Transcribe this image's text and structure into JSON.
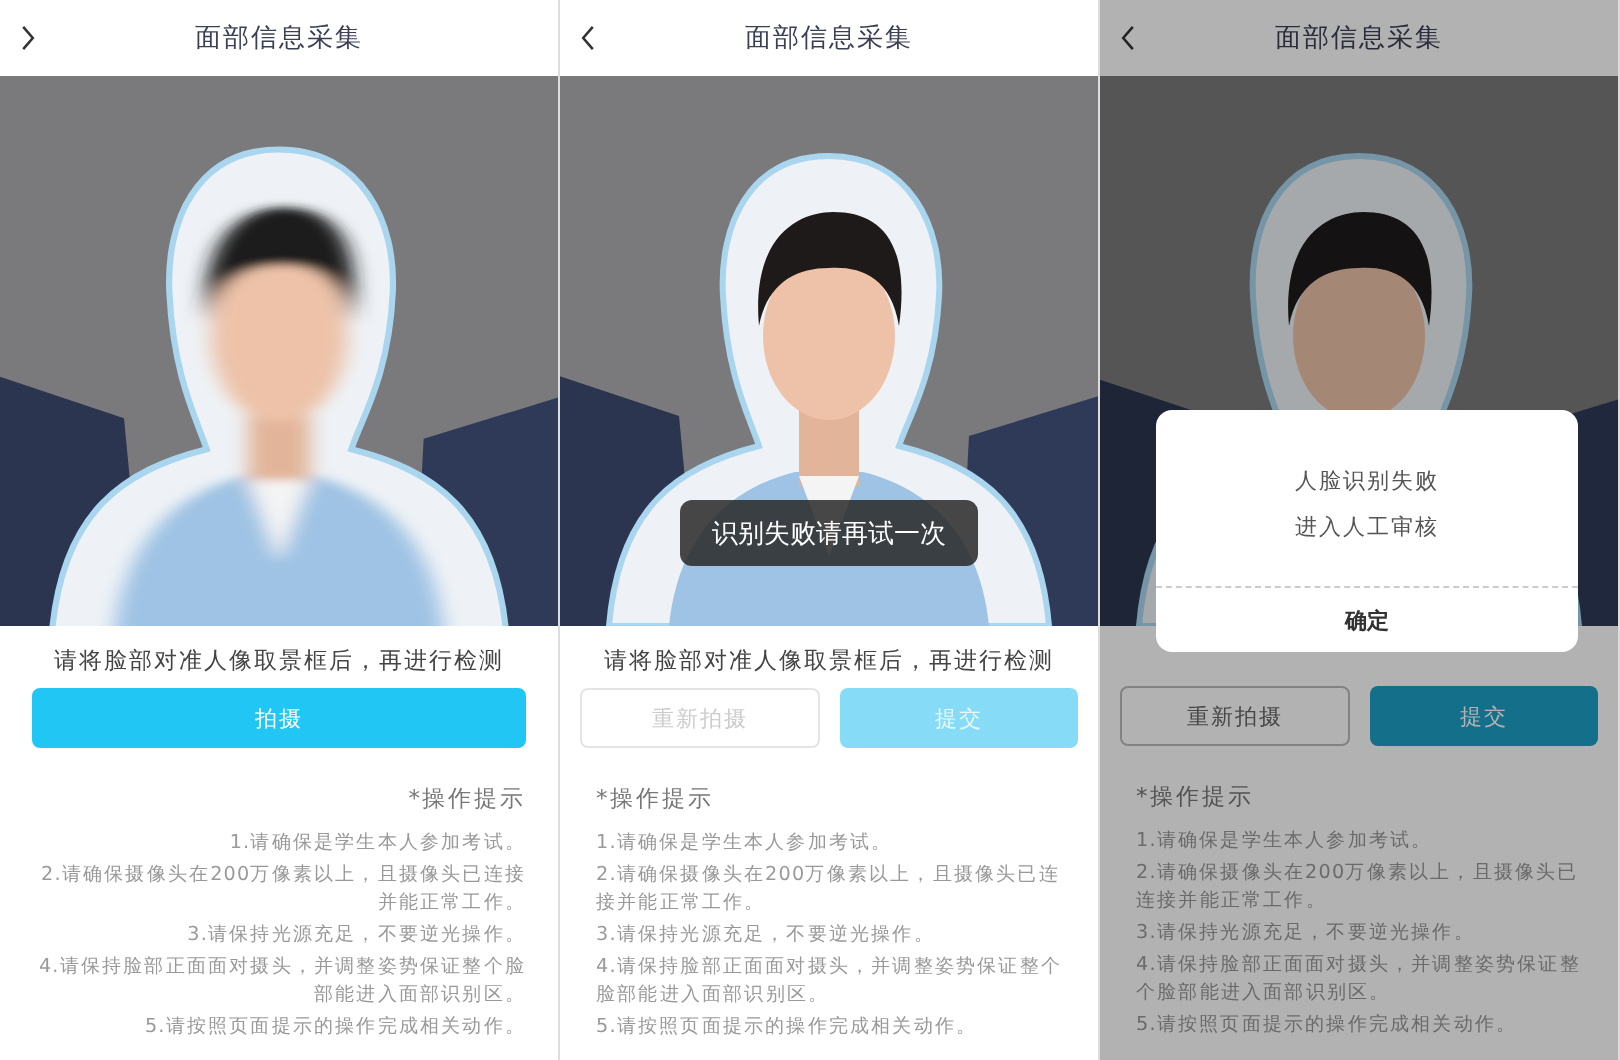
{
  "screens": [
    {
      "kind": "mirrored",
      "blurred": true,
      "title": "面部信息采集",
      "prompt": "请将脸部对准人像取景框后，再进行检测",
      "buttons": [
        {
          "label": "拍摄",
          "kind": "primary",
          "disabled": false
        }
      ],
      "tips_title": "*操作提示",
      "tips": [
        "1.请确保是学生本人参加考试。",
        "2.请确保摄像头在200万像素以上，且摄像头已连接并能正常工作。",
        "3.请保持光源充足，不要逆光操作。",
        "4.请保持脸部正面面对摄头，并调整姿势保证整个脸部能进入面部识别区。",
        "5.请按照页面提示的操作完成相关动作。"
      ]
    },
    {
      "kind": "normal",
      "title": "面部信息采集",
      "toast": "识别失败请再试一次",
      "prompt": "请将脸部对准人像取景框后，再进行检测",
      "buttons": [
        {
          "label": "重新拍摄",
          "kind": "secondary",
          "disabled": true
        },
        {
          "label": "提交",
          "kind": "primary",
          "disabled": true
        }
      ],
      "tips_title": "*操作提示",
      "tips": [
        "1.请确保是学生本人参加考试。",
        "2.请确保摄像头在200万像素以上，且摄像头已连接并能正常工作。",
        "3.请保持光源充足，不要逆光操作。",
        "4.请保持脸部正面面对摄头，并调整姿势保证整个脸部能进入面部识别区。",
        "5.请按照页面提示的操作完成相关动作。"
      ]
    },
    {
      "kind": "normal",
      "dimmed": true,
      "title": "面部信息采集",
      "dialog": {
        "lines": [
          "人脸识别失败",
          "进入人工审核"
        ],
        "button": "确定"
      },
      "buttons": [
        {
          "label": "重新拍摄",
          "kind": "secondary",
          "disabled": false
        },
        {
          "label": "提交",
          "kind": "primary",
          "disabled": false
        }
      ],
      "tips_title": "*操作提示",
      "tips": [
        "1.请确保是学生本人参加考试。",
        "2.请确保摄像头在200万像素以上，且摄像头已连接并能正常工作。",
        "3.请保持光源充足，不要逆光操作。",
        "4.请保持脸部正面面对摄头，并调整姿势保证整个脸部能进入面部识别区。",
        "5.请按照页面提示的操作完成相关动作。"
      ]
    }
  ]
}
